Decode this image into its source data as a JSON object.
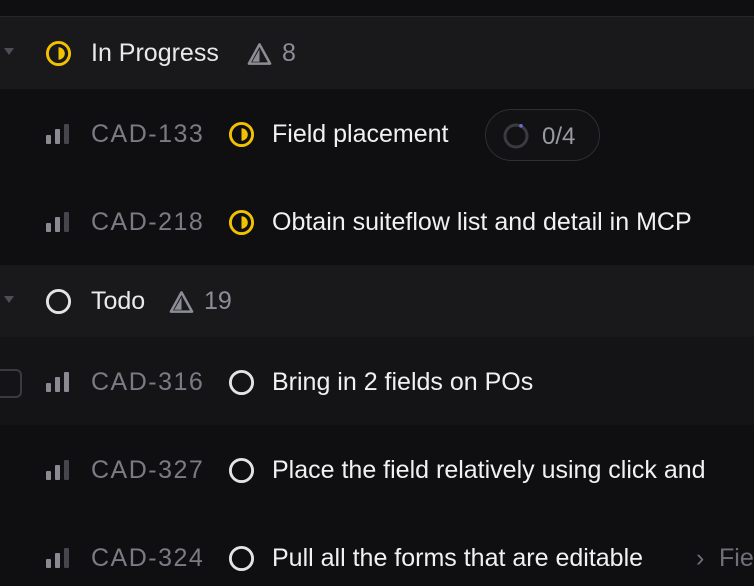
{
  "groups": [
    {
      "label": "In Progress",
      "count": "8"
    },
    {
      "label": "Todo",
      "count": "19"
    }
  ],
  "issues": [
    {
      "id": "CAD-133",
      "title": "Field placement",
      "subtasks": "0/4"
    },
    {
      "id": "CAD-218",
      "title": "Obtain suiteflow list and detail in MCP"
    },
    {
      "id": "CAD-316",
      "title": "Bring in 2 fields on POs"
    },
    {
      "id": "CAD-327",
      "title": "Place the field relatively using click and"
    },
    {
      "id": "CAD-324",
      "title": "Pull all the forms that are editable",
      "parent_crumb": "Fie"
    }
  ],
  "icons": {
    "caret": "chevron-down-icon",
    "in_progress": "in-progress-status-icon",
    "todo": "todo-status-icon",
    "triangle": "triangle-count-icon",
    "priority": "priority-bars-icon",
    "spinner": "progress-spinner-icon",
    "breadcrumb": "chevron-right-icon"
  },
  "colors": {
    "background": "#0f0f11",
    "group_header": "#19191c",
    "in_progress": "#f2c200",
    "todo": "#e3e3e6",
    "muted_text": "#7b7b84"
  }
}
